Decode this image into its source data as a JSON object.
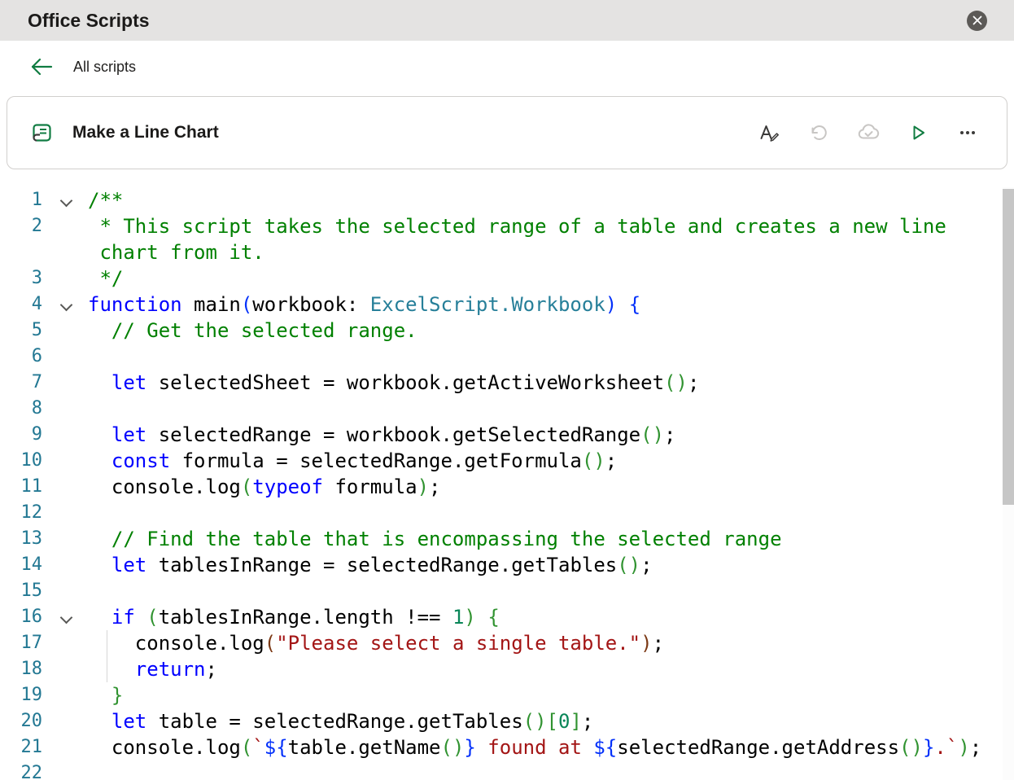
{
  "header": {
    "title": "Office Scripts"
  },
  "nav": {
    "back_label": "All scripts"
  },
  "script_card": {
    "title": "Make a Line Chart",
    "actions": {
      "rename": "Rename script",
      "undo": "Undo",
      "sync": "Saved",
      "run": "Run",
      "more": "More options"
    }
  },
  "colors": {
    "accent_green": "#107c41",
    "topbar_bg": "#e4e3e2",
    "line_number": "#237893",
    "keyword": "#0000ff",
    "comment": "#008000",
    "type": "#267f99",
    "string": "#a31515",
    "number": "#098658",
    "bracket_level1": "#0431fa",
    "bracket_level2": "#319331",
    "bracket_level3": "#7b3814"
  },
  "editor": {
    "language": "TypeScript",
    "lines": [
      {
        "n": 1,
        "fold": true,
        "tokens": [
          [
            "cm",
            "/**"
          ]
        ]
      },
      {
        "n": 2,
        "wrap": true,
        "guide": true,
        "tokens": [
          [
            "cm",
            " * This script takes the selected range of a table and creates a new line chart from it."
          ]
        ]
      },
      {
        "n": 3,
        "guide": true,
        "tokens": [
          [
            "cm",
            " */"
          ]
        ]
      },
      {
        "n": 4,
        "fold": true,
        "tokens": [
          [
            "kw",
            "function"
          ],
          [
            "pl",
            " main"
          ],
          [
            "b1",
            "("
          ],
          [
            "pl",
            "workbook: "
          ],
          [
            "ty",
            "ExcelScript.Workbook"
          ],
          [
            "b1",
            ")"
          ],
          [
            "pl",
            " "
          ],
          [
            "b1",
            "{"
          ]
        ]
      },
      {
        "n": 5,
        "guide": true,
        "tokens": [
          [
            "pl",
            "  "
          ],
          [
            "cm",
            "// Get the selected range."
          ]
        ]
      },
      {
        "n": 6,
        "guide": true,
        "tokens": []
      },
      {
        "n": 7,
        "guide": true,
        "tokens": [
          [
            "pl",
            "  "
          ],
          [
            "kw",
            "let"
          ],
          [
            "pl",
            " selectedSheet = workbook.getActiveWorksheet"
          ],
          [
            "b2",
            "()"
          ],
          [
            "pl",
            ";"
          ]
        ]
      },
      {
        "n": 8,
        "guide": true,
        "tokens": []
      },
      {
        "n": 9,
        "guide": true,
        "tokens": [
          [
            "pl",
            "  "
          ],
          [
            "kw",
            "let"
          ],
          [
            "pl",
            " selectedRange = workbook.getSelectedRange"
          ],
          [
            "b2",
            "()"
          ],
          [
            "pl",
            ";"
          ]
        ]
      },
      {
        "n": 10,
        "guide": true,
        "tokens": [
          [
            "pl",
            "  "
          ],
          [
            "kw",
            "const"
          ],
          [
            "pl",
            " formula = selectedRange.getFormula"
          ],
          [
            "b2",
            "()"
          ],
          [
            "pl",
            ";"
          ]
        ]
      },
      {
        "n": 11,
        "guide": true,
        "tokens": [
          [
            "pl",
            "  console.log"
          ],
          [
            "b2",
            "("
          ],
          [
            "kw",
            "typeof"
          ],
          [
            "pl",
            " formula"
          ],
          [
            "b2",
            ")"
          ],
          [
            "pl",
            ";"
          ]
        ]
      },
      {
        "n": 12,
        "guide": true,
        "tokens": []
      },
      {
        "n": 13,
        "guide": true,
        "tokens": [
          [
            "pl",
            "  "
          ],
          [
            "cm",
            "// Find the table that is encompassing the selected range"
          ]
        ]
      },
      {
        "n": 14,
        "guide": true,
        "tokens": [
          [
            "pl",
            "  "
          ],
          [
            "kw",
            "let"
          ],
          [
            "pl",
            " tablesInRange = selectedRange.getTables"
          ],
          [
            "b2",
            "()"
          ],
          [
            "pl",
            ";"
          ]
        ]
      },
      {
        "n": 15,
        "guide": true,
        "tokens": []
      },
      {
        "n": 16,
        "fold": true,
        "guide": true,
        "tokens": [
          [
            "pl",
            "  "
          ],
          [
            "kw",
            "if"
          ],
          [
            "pl",
            " "
          ],
          [
            "b2",
            "("
          ],
          [
            "pl",
            "tablesInRange.length !== "
          ],
          [
            "nu",
            "1"
          ],
          [
            "b2",
            ")"
          ],
          [
            "pl",
            " "
          ],
          [
            "b2",
            "{"
          ]
        ]
      },
      {
        "n": 17,
        "guide": true,
        "guide2": true,
        "tokens": [
          [
            "pl",
            "    console.log"
          ],
          [
            "b3",
            "("
          ],
          [
            "st",
            "\"Please select a single table.\""
          ],
          [
            "b3",
            ")"
          ],
          [
            "pl",
            ";"
          ]
        ]
      },
      {
        "n": 18,
        "guide": true,
        "guide2": true,
        "tokens": [
          [
            "pl",
            "    "
          ],
          [
            "kw",
            "return"
          ],
          [
            "pl",
            ";"
          ]
        ]
      },
      {
        "n": 19,
        "guide": true,
        "tokens": [
          [
            "pl",
            "  "
          ],
          [
            "b2",
            "}"
          ]
        ]
      },
      {
        "n": 20,
        "guide": true,
        "tokens": [
          [
            "pl",
            "  "
          ],
          [
            "kw",
            "let"
          ],
          [
            "pl",
            " table = selectedRange.getTables"
          ],
          [
            "b2",
            "()"
          ],
          [
            "b2",
            "["
          ],
          [
            "nu",
            "0"
          ],
          [
            "b2",
            "]"
          ],
          [
            "pl",
            ";"
          ]
        ]
      },
      {
        "n": 21,
        "guide": true,
        "tokens": [
          [
            "pl",
            "  console.log"
          ],
          [
            "b2",
            "("
          ],
          [
            "st",
            "`"
          ],
          [
            "ib",
            "${"
          ],
          [
            "pl",
            "table.getName"
          ],
          [
            "b2",
            "()"
          ],
          [
            "ib",
            "}"
          ],
          [
            "st",
            " found at "
          ],
          [
            "ib",
            "${"
          ],
          [
            "pl",
            "selectedRange.getAddress"
          ],
          [
            "b2",
            "()"
          ],
          [
            "ib",
            "}"
          ],
          [
            "st",
            ".`"
          ],
          [
            "b2",
            ")"
          ],
          [
            "pl",
            ";"
          ]
        ]
      },
      {
        "n": 22,
        "guide": true,
        "tokens": []
      }
    ]
  }
}
